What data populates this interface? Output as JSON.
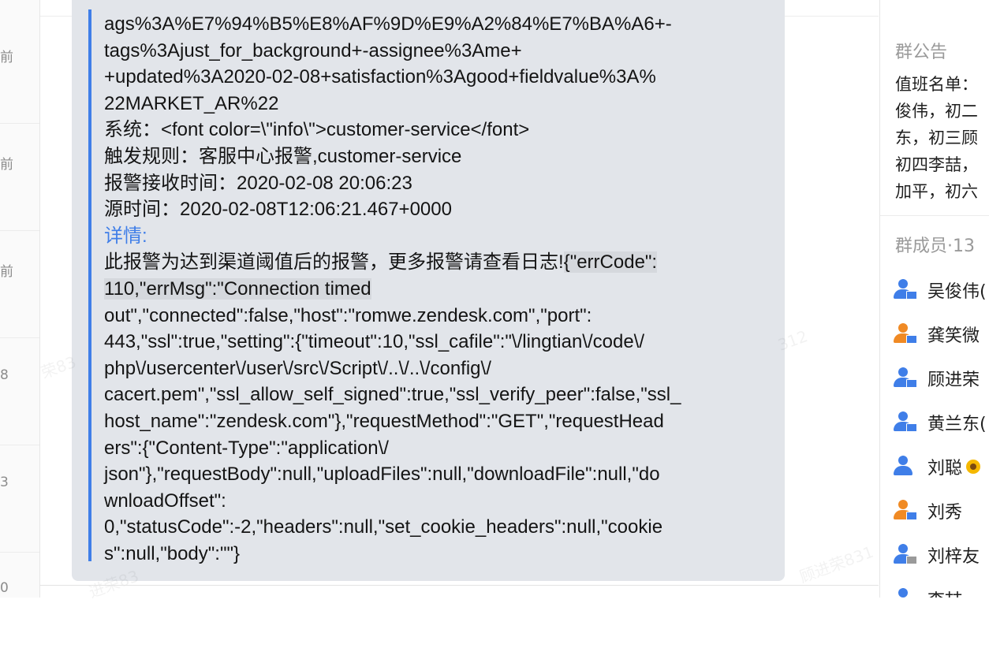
{
  "left_list": {
    "items": [
      {
        "char": "前"
      },
      {
        "char": "前"
      },
      {
        "char": "前"
      },
      {
        "char": "8"
      },
      {
        "char": "3"
      },
      {
        "char": "0"
      }
    ]
  },
  "message": {
    "url_lines": [
      "ags%3A%E7%94%B5%E8%AF%9D%E9%A2%84%E7%BA%A6+-",
      "tags%3Ajust_for_background+-assignee%3Ame+",
      "+updated%3A2020-02-08+satisfaction%3Agood+fieldvalue%3A%",
      "22MARKET_AR%22"
    ],
    "system_line": "系统：<font color=\\\"info\\\">customer-service</font>",
    "trigger_line": "触发规则：客服中心报警,customer-service",
    "receive_time_line": "报警接收时间：2020-02-08 20:06:23",
    "source_time_line": "源时间：2020-02-08T12:06:21.467+0000",
    "details_label": "详情:",
    "detail_line_1_text": "此报警为达到渠道阈值后的报警，更多报警请查看日志!",
    "detail_line_1_highlight": "{\"errCode\":",
    "detail_line_2_highlight": "110,\"errMsg\":\"Connection timed",
    "detail_lines": [
      "out\",\"connected\":false,\"host\":\"romwe.zendesk.com\",\"port\":",
      "443,\"ssl\":true,\"setting\":{\"timeout\":10,\"ssl_cafile\":\"\\/lingtian\\/code\\/",
      "php\\/usercenter\\/user\\/src\\/Script\\/..\\/..\\/config\\/",
      "cacert.pem\",\"ssl_allow_self_signed\":true,\"ssl_verify_peer\":false,\"ssl_",
      "host_name\":\"zendesk.com\"},\"requestMethod\":\"GET\",\"requestHead",
      "ers\":{\"Content-Type\":\"application\\/",
      "json\"},\"requestBody\":null,\"uploadFiles\":null,\"downloadFile\":null,\"do",
      "wnloadOffset\":",
      "0,\"statusCode\":-2,\"headers\":null,\"set_cookie_headers\":null,\"cookie",
      "s\":null,\"body\":\"\"}"
    ]
  },
  "watermarks": [
    "荣83",
    "312",
    "顾进荣831",
    "进荣83"
  ],
  "side_panel": {
    "notice_title": "群公告",
    "notice_lines": [
      "值班名单：",
      "俊伟，初二",
      "东，初三顾",
      "初四李喆，",
      "加平，初六"
    ],
    "members_title": "群成员·13",
    "members": [
      {
        "name": "吴俊伟(",
        "icon": "user-pc-icon",
        "color": "#3f7ee8"
      },
      {
        "name": "龚笑微",
        "icon": "user-pc-icon",
        "color": "#f08a24"
      },
      {
        "name": "顾进荣",
        "icon": "user-pc-icon",
        "color": "#3f7ee8"
      },
      {
        "name": "黄兰东(",
        "icon": "user-pc-icon",
        "color": "#3f7ee8"
      },
      {
        "name": "刘聪",
        "icon": "user-icon",
        "color": "#3f7ee8",
        "flower": true
      },
      {
        "name": "刘秀",
        "icon": "user-pc-icon",
        "color": "#f08a24"
      },
      {
        "name": "刘梓友",
        "icon": "user-offline-icon",
        "color": "#3f7ee8"
      },
      {
        "name": "李喆",
        "icon": "user-icon",
        "color": "#3f7ee8"
      }
    ]
  }
}
